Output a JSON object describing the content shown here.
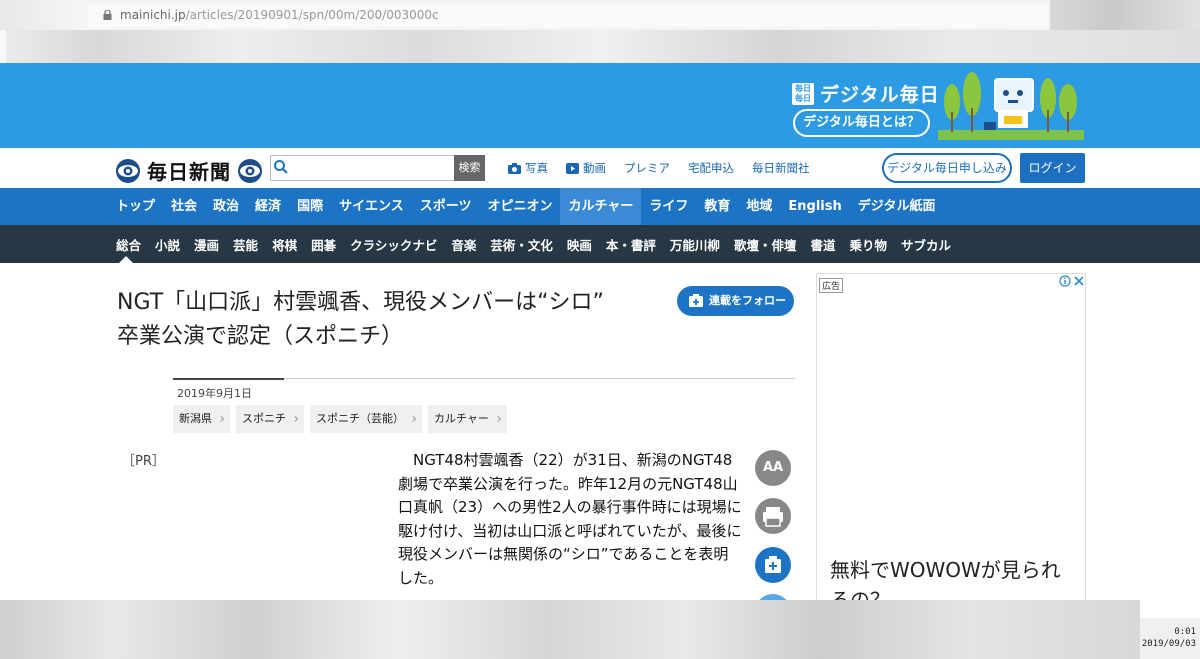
{
  "browser": {
    "url_host": "mainichi.jp",
    "url_path": "/articles/20190901/spn/00m/200/003000c"
  },
  "promo": {
    "mark": "毎日 毎日",
    "title": "デジタル毎日",
    "button": "デジタル毎日とは？"
  },
  "header": {
    "logo": "毎日新聞",
    "search_placeholder": "",
    "search_button": "検索",
    "links": [
      "写真",
      "動画",
      "プレミア",
      "宅配申込",
      "毎日新聞社"
    ],
    "apply_button": "デジタル毎日申し込み",
    "login_button": "ログイン"
  },
  "nav_main": [
    "トップ",
    "社会",
    "政治",
    "経済",
    "国際",
    "サイエンス",
    "スポーツ",
    "オピニオン",
    "カルチャー",
    "ライフ",
    "教育",
    "地域",
    "English",
    "デジタル紙面"
  ],
  "nav_main_active": "カルチャー",
  "nav_sub": [
    "総合",
    "小説",
    "漫画",
    "芸能",
    "将棋",
    "囲碁",
    "クラシックナビ",
    "音楽",
    "芸術・文化",
    "映画",
    "本・書評",
    "万能川柳",
    "歌壇・俳壇",
    "書道",
    "乗り物",
    "サブカル"
  ],
  "article": {
    "title_line1": "NGT「山口派」村雲颯香、現役メンバーは“シロ”",
    "title_line2": "卒業公演で認定（スポニチ）",
    "follow_button": "連載をフォロー",
    "date": "2019年9月1日",
    "tags": [
      "新潟県",
      "スポニチ",
      "スポニチ（芸能）",
      "カルチャー"
    ],
    "pr_label": "［PR］",
    "body": "　NGT48村雲颯香（22）が31日、新潟のNGT48劇場で卒業公演を行った。昨年12月の元NGT48山口真帆（23）への男性2人の暴行事件時には現場に駆け付け、当初は山口派と呼ばれていたが、最後に現役メンバーは無関係の“シロ”であることを表明した。"
  },
  "tools": {
    "font_size": "AA"
  },
  "ad": {
    "label": "広告",
    "text": "無料でWOWOWが見られるの？"
  },
  "taskbar": {
    "time": "0:01",
    "date": "2019/09/03"
  },
  "colors": {
    "promo_blue": "#2d9be3",
    "nav_blue": "#1d74c5",
    "subnav_dark": "#273744"
  }
}
